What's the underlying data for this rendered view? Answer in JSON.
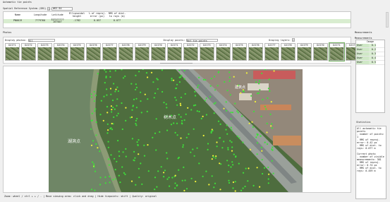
{
  "title": "Automatic tie points",
  "srs": {
    "label": "Spatial Reference System (SRS)",
    "value": "WGS 84"
  },
  "table": {
    "headers": [
      "Name",
      "Longitude",
      "Latitude",
      "Ellipsoidal height",
      "% of reproj. error (px)",
      "RMS of dist. to rays (m)"
    ],
    "rows": [
      [
        "PN0019",
        "7??9?60",
        "33?3????? 26?00?",
        "-1?82",
        "0.05?",
        "0.077"
      ]
    ]
  },
  "photos": {
    "section_label": "Photos",
    "display_label": "Display photos:",
    "filter_value": "All",
    "display_points_label": "Display points:",
    "points_filter_value": "Not tie points",
    "display_layers_label": "Display layers:",
    "thumbs": [
      "DJI?1",
      "DJI?2",
      "DJI?3",
      "DJI?4",
      "DJI?5",
      "DJI?6",
      "DJI?7",
      "DJI?8",
      "DJI?9",
      "DJI?0",
      "DJI?1",
      "DJI?2",
      "DJI?3",
      "DJI?4",
      "DJI?5",
      "DJI?6",
      "DJI?7",
      "DJI?8",
      "DJI?9",
      "DJI?0",
      "DJI?1",
      "DJI?2"
    ],
    "selected_index": 20
  },
  "map_labels": {
    "river": "湖滨点",
    "center": "树木点",
    "top": "建筑点"
  },
  "right": {
    "measurements_title": "Measurements",
    "measurements_sub": "Measurements",
    "image_label": "Image",
    "rows": [
      [
        "User",
        "0.1"
      ],
      [
        "User",
        "0.2"
      ],
      [
        "User",
        "0.3"
      ],
      [
        "User",
        "0.4"
      ],
      [
        "User",
        "0.5"
      ]
    ],
    "statistics_title": "Statistics",
    "stats_text": "All automatic tie points\n- number of points: 1\n- RMS of reproj. error: 0.42 px\n- RMS of dist. to rays: 0.077 m\n\nCurrent photo\n- number of visible measurements: 381\n- RMS of reproj. error: 0.74 px\n- RMS of dist. to rays: 0.459 m"
  },
  "status": {
    "zoom": "Zoom: wheel / ctrl + + / -",
    "move": "Move viewing area: click and drag",
    "hide": "Hide tiepoints: shift",
    "quality": "Quality: original"
  }
}
